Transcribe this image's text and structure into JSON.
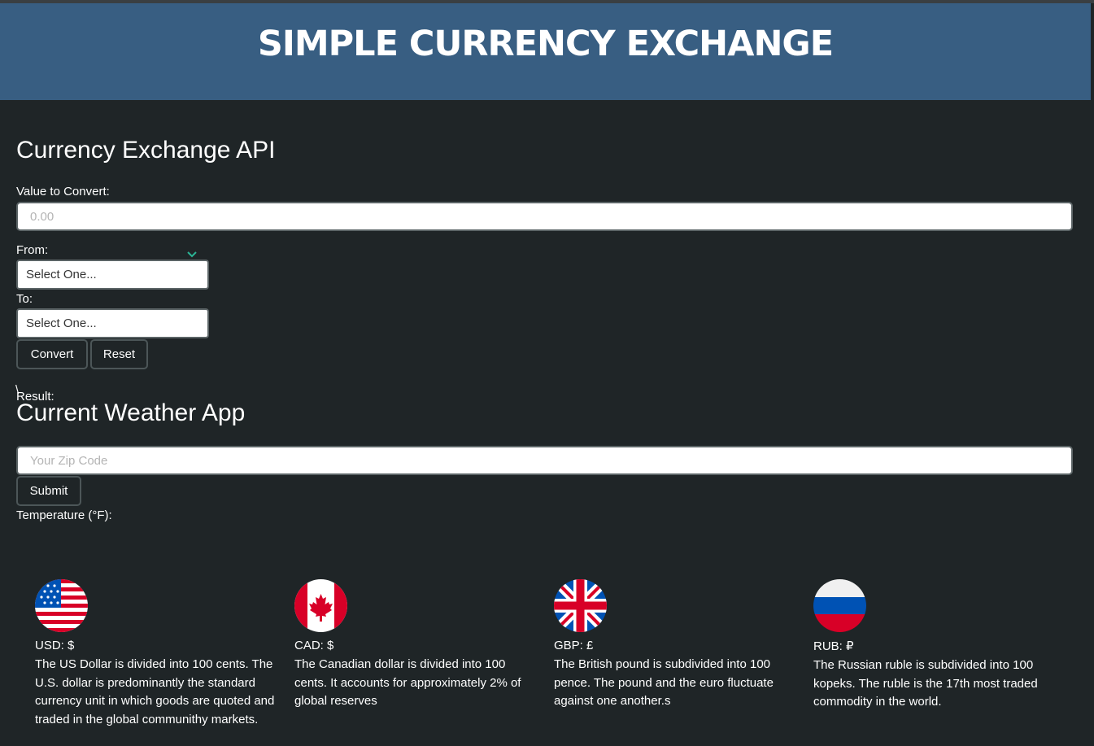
{
  "header": {
    "title": "SIMPLE CURRENCY EXCHANGE"
  },
  "exchange": {
    "heading": "Currency Exchange API",
    "value_label": "Value to Convert:",
    "value_placeholder": "0.00",
    "from_label": "From:",
    "from_selected": "Select One...",
    "to_label": "To:",
    "to_selected": "Select One...",
    "convert_label": "Convert",
    "reset_label": "Reset",
    "stray_char": "\\",
    "result_label": "Result:"
  },
  "weather": {
    "heading": "Current Weather App",
    "zip_placeholder": "Your Zip Code",
    "submit_label": "Submit",
    "temperature_label": "Temperature (°F):"
  },
  "currencies": [
    {
      "flag_icon": "us-flag-icon",
      "code": "USD: $",
      "description": "The US Dollar is divided into 100 cents. The U.S. dollar is predominantly the standard currency unit in which goods are quoted and traded in the global communithy markets."
    },
    {
      "flag_icon": "canada-flag-icon",
      "code": "CAD: $",
      "description": "The Canadian dollar is divided into 100 cents. It accounts for approximately 2% of global reserves"
    },
    {
      "flag_icon": "uk-flag-icon",
      "code": "GBP: £",
      "description": "The British pound is subdivided into 100 pence. The pound and the euro fluctuate against one another.s"
    },
    {
      "flag_icon": "russia-flag-icon",
      "code": "RUB: ₽",
      "description": "The Russian ruble is subdivided into 100 kopeks. The ruble is the 17th most traded commodity in the world."
    }
  ],
  "colors": {
    "background": "#1f2527",
    "header_bg": "#385e82",
    "chevron": "#2bb596"
  }
}
